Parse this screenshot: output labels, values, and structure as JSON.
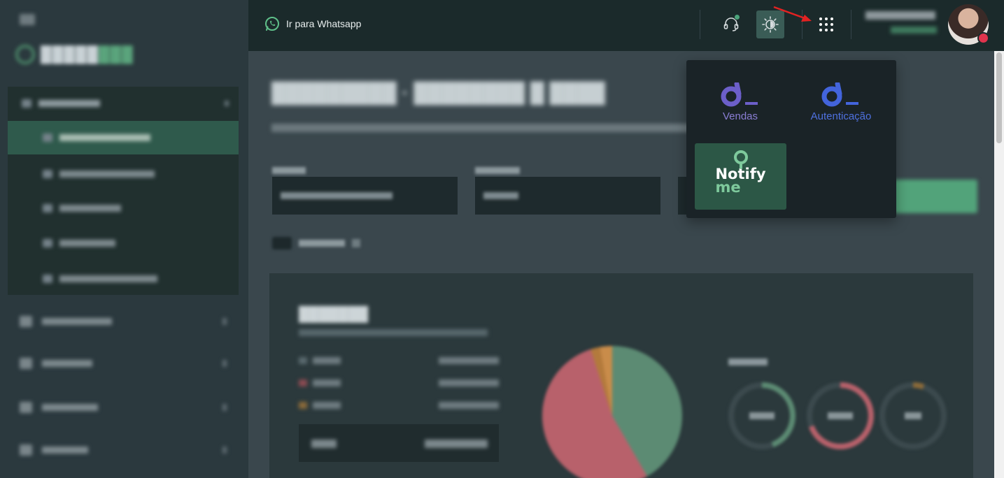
{
  "header": {
    "whatsapp_link": "Ir para Whatsapp"
  },
  "app_switcher": {
    "apps": [
      {
        "label": "Vendas",
        "color": "#8a7ed4"
      },
      {
        "label": "Autenticação",
        "color": "#4f71e0"
      },
      {
        "logo_text_1": "Notify",
        "logo_text_2": "me",
        "color": "#2c5746"
      }
    ]
  },
  "colors": {
    "sidebar_bg": "#2b393e",
    "header_bg": "#1b2a2b",
    "main_bg": "#3a474d",
    "popup_bg": "#1a2327",
    "accent_green": "#4ca37b",
    "status_red": "#e0344d"
  },
  "icons": {
    "whatsapp": "whatsapp-icon",
    "support": "headset-icon",
    "theme": "sun-icon",
    "apps": "grid-icon",
    "annotation": "red-arrow-icon"
  }
}
